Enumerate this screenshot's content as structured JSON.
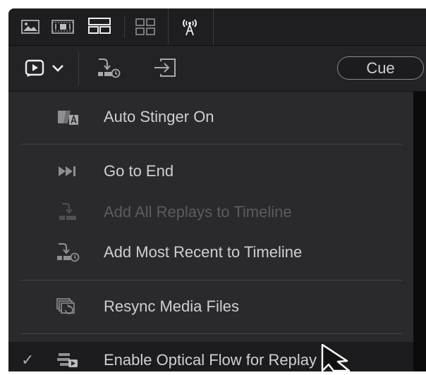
{
  "toolbar": {
    "icons": [
      "image-icon",
      "filmstrip-icon",
      "timeline-layout-icon",
      "grid-icon",
      "broadcast-icon"
    ],
    "cue_label": "Cue"
  },
  "menu": {
    "items": [
      {
        "label": "Auto Stinger On",
        "icon": "stinger-icon",
        "enabled": true,
        "checked": false
      },
      {
        "label": "Go to End",
        "icon": "skip-to-end-icon",
        "enabled": true,
        "checked": false
      },
      {
        "label": "Add All Replays to Timeline",
        "icon": "add-all-replays-icon",
        "enabled": false,
        "checked": false
      },
      {
        "label": "Add Most Recent to Timeline",
        "icon": "add-recent-icon",
        "enabled": true,
        "checked": false
      },
      {
        "label": "Resync Media Files",
        "icon": "resync-icon",
        "enabled": true,
        "checked": false
      },
      {
        "label": "Enable Optical Flow for Replay",
        "icon": "optical-flow-icon",
        "enabled": true,
        "checked": true,
        "check_mark": "✓"
      }
    ]
  }
}
